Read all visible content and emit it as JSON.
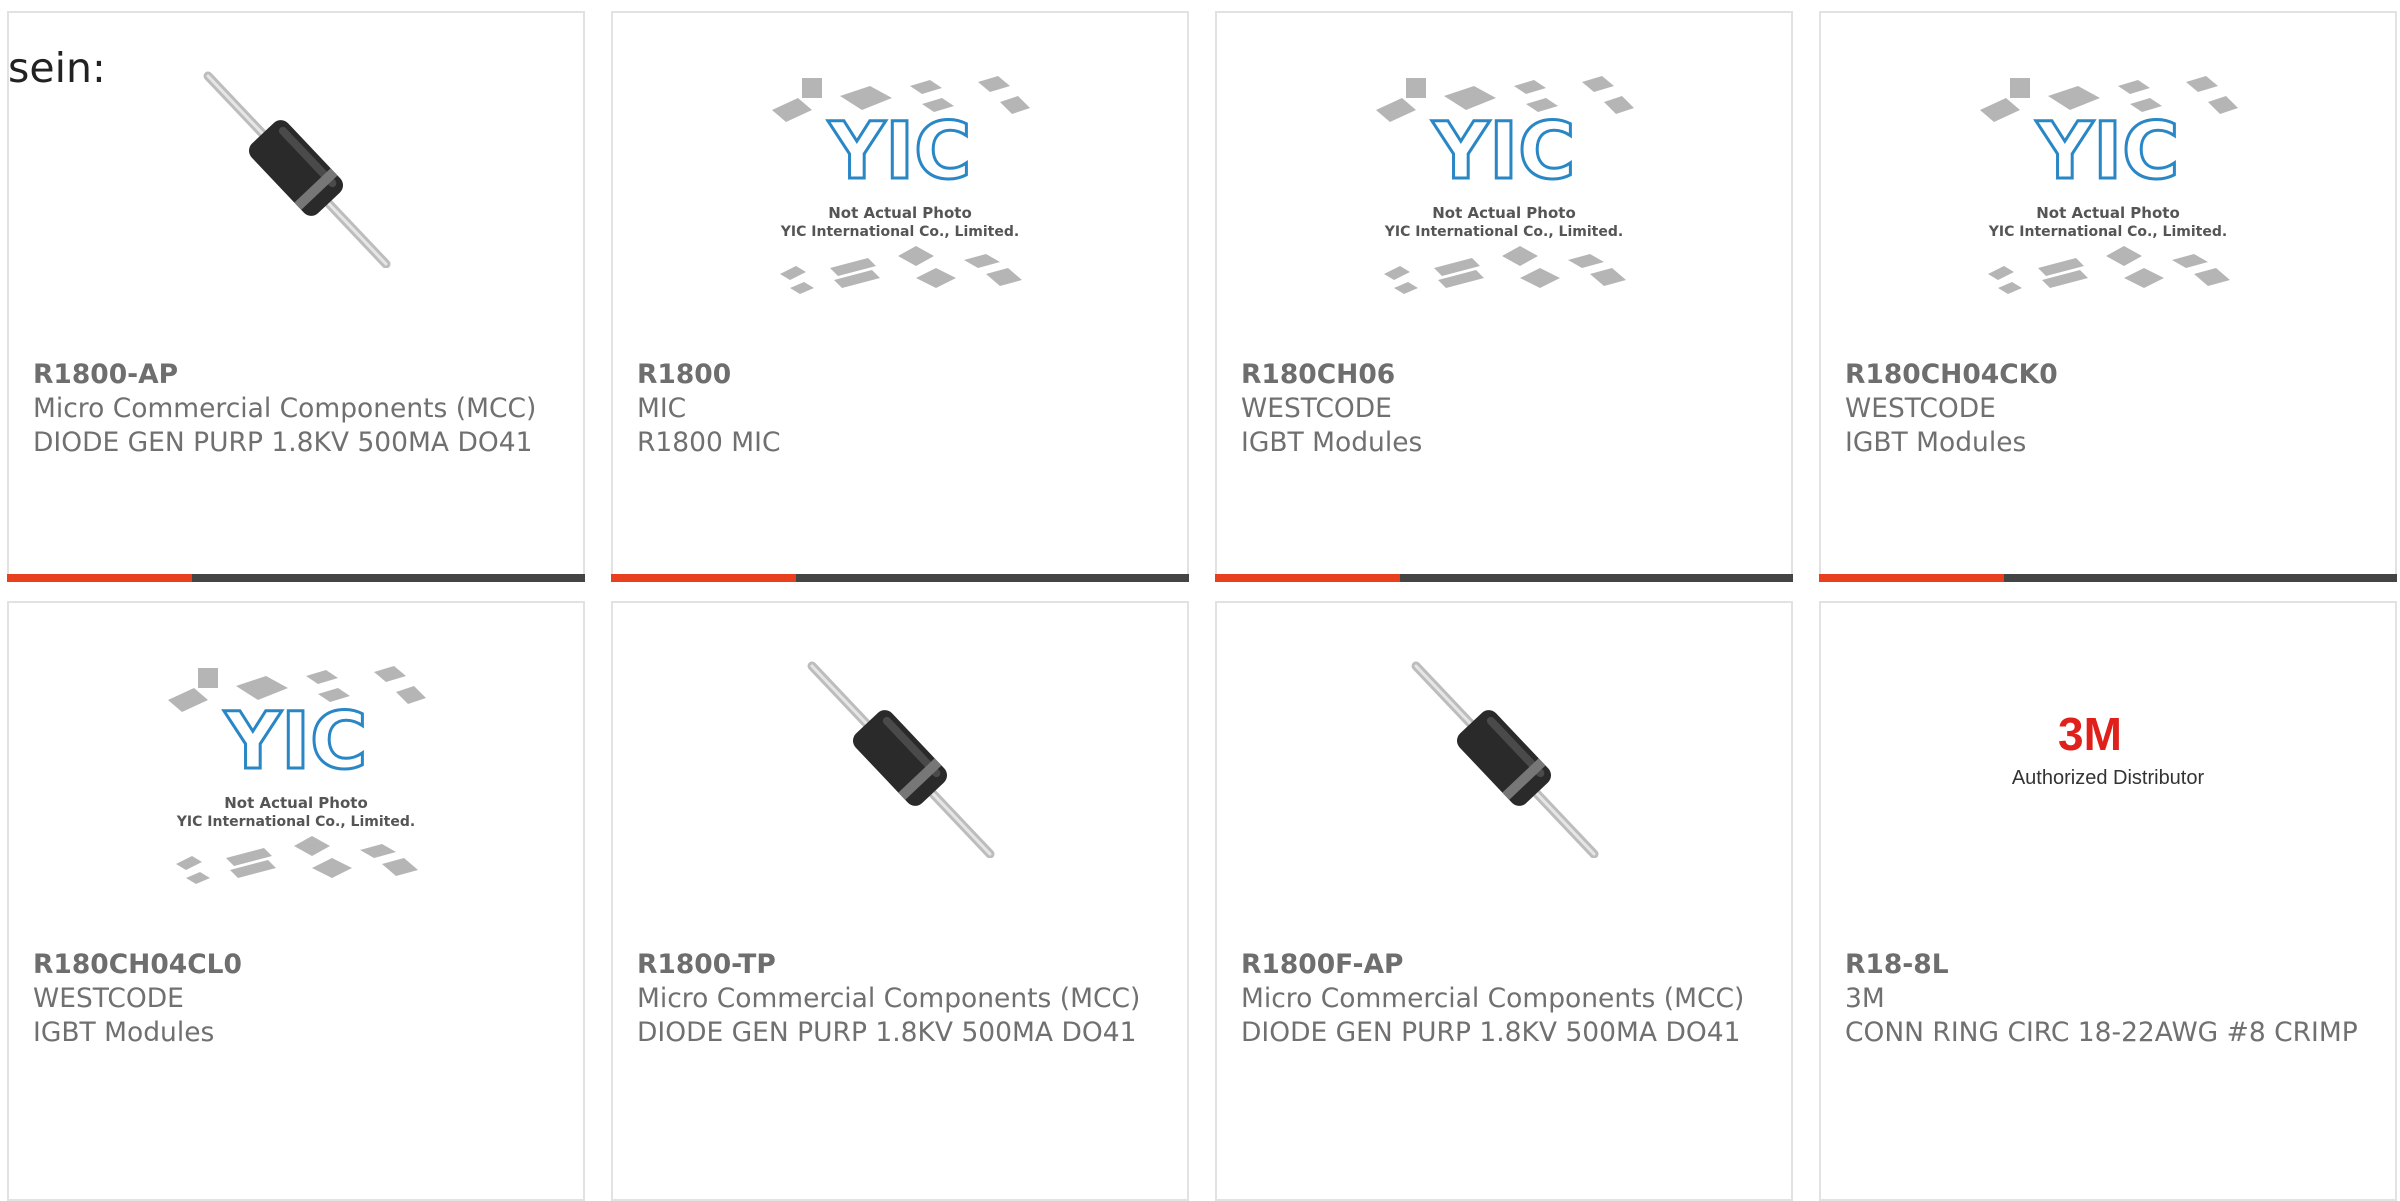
{
  "lead_text": "sein:",
  "colors": {
    "accent": "#e8401e",
    "bar_dark": "#444444",
    "border": "#e2e2e2",
    "text": "#707070",
    "yic_blue": "#2a87c6",
    "brand_3m": "#e0201b"
  },
  "placeholder_image": {
    "line1": "Not Actual Photo",
    "line2": "YIC International Co., Limited.",
    "logo_text": "YIC"
  },
  "logo_3m": {
    "brand": "3M",
    "subtitle": "Authorized Distributor"
  },
  "products": [
    {
      "part": "R1800-AP",
      "manufacturer": "Micro Commercial Components (MCC)",
      "description": "DIODE GEN PURP 1.8KV 500MA DO41",
      "image": "diode-image"
    },
    {
      "part": "R1800",
      "manufacturer": "MIC",
      "description": "R1800 MIC",
      "image": "placeholder-image"
    },
    {
      "part": "R180CH06",
      "manufacturer": "WESTCODE",
      "description": "IGBT Modules",
      "image": "placeholder-image"
    },
    {
      "part": "R180CH04CK0",
      "manufacturer": "WESTCODE",
      "description": "IGBT Modules",
      "image": "placeholder-image"
    },
    {
      "part": "R180CH04CL0",
      "manufacturer": "WESTCODE",
      "description": "IGBT Modules",
      "image": "placeholder-image"
    },
    {
      "part": "R1800-TP",
      "manufacturer": "Micro Commercial Components (MCC)",
      "description": "DIODE GEN PURP 1.8KV 500MA DO41",
      "image": "diode-image"
    },
    {
      "part": "R1800F-AP",
      "manufacturer": "Micro Commercial Components (MCC)",
      "description": "DIODE GEN PURP 1.8KV 500MA DO41",
      "image": "diode-image"
    },
    {
      "part": "R18-8L",
      "manufacturer": "3M",
      "description": "CONN RING CIRC 18-22AWG #8 CRIMP",
      "image": "3m-logo-image"
    }
  ]
}
